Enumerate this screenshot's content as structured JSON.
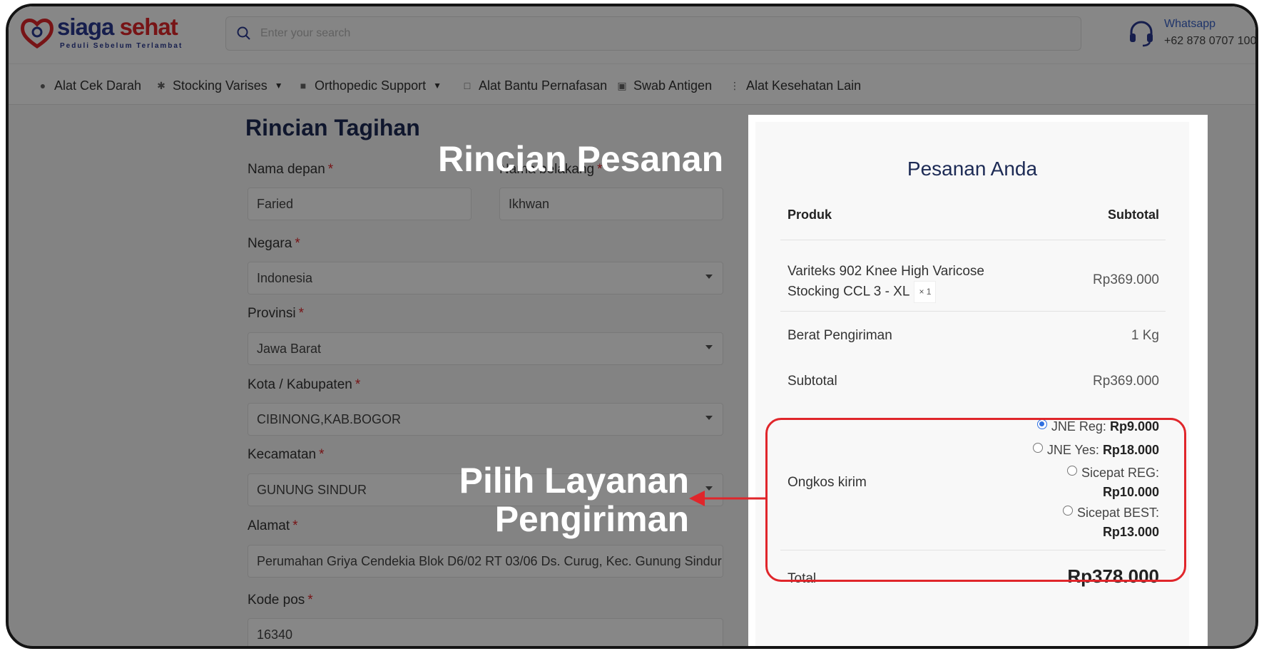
{
  "header": {
    "logo": {
      "brand_first": "siaga",
      "brand_second": "sehat",
      "tagline": "Peduli Sebelum Terlambat"
    },
    "search": {
      "placeholder": "Enter your search",
      "value": ""
    },
    "whatsapp": {
      "label": "Whatsapp",
      "number": "+62 878 0707 1000"
    }
  },
  "nav": {
    "items": [
      {
        "label": "Alat Cek Darah",
        "icon": "blood-drop-icon",
        "has_dropdown": false
      },
      {
        "label": "Stocking Varises",
        "icon": "leg-icon",
        "has_dropdown": true
      },
      {
        "label": "Orthopedic Support",
        "icon": "knee-support-icon",
        "has_dropdown": true
      },
      {
        "label": "Alat Bantu Pernafasan",
        "icon": "lungs-icon",
        "has_dropdown": false
      },
      {
        "label": "Swab Antigen",
        "icon": "test-kit-icon",
        "has_dropdown": false
      },
      {
        "label": "Alat Kesehatan Lain",
        "icon": "more-icon",
        "has_dropdown": false
      }
    ]
  },
  "form": {
    "title": "Rincian Tagihan",
    "required_mark": "*",
    "first_name": {
      "label": "Nama depan",
      "value": "Faried"
    },
    "last_name": {
      "label": "Nama belakang",
      "value": "Ikhwan"
    },
    "country": {
      "label": "Negara",
      "value": "Indonesia"
    },
    "province": {
      "label": "Provinsi",
      "value": "Jawa Barat"
    },
    "city": {
      "label": "Kota / Kabupaten",
      "value": "CIBINONG,KAB.BOGOR"
    },
    "district": {
      "label": "Kecamatan",
      "value": "GUNUNG SINDUR"
    },
    "address": {
      "label": "Alamat",
      "value": "Perumahan Griya Cendekia Blok D6/02 RT 03/06 Ds. Curug, Kec. Gunung Sindur"
    },
    "postal_code": {
      "label": "Kode pos",
      "value": "16340"
    }
  },
  "order": {
    "title": "Pesanan Anda",
    "col_product": "Produk",
    "col_subtotal": "Subtotal",
    "product": {
      "name": "Variteks 902 Knee High Varicose Stocking CCL 3 - XL",
      "qty": "× 1",
      "price": "Rp369.000"
    },
    "weight": {
      "label": "Berat Pengiriman",
      "value": "1 Kg"
    },
    "subtotal": {
      "label": "Subtotal",
      "value": "Rp369.000"
    },
    "shipping": {
      "label": "Ongkos kirim",
      "options": [
        {
          "name": "JNE Reg:",
          "price": "Rp9.000",
          "selected": true
        },
        {
          "name": "JNE Yes:",
          "price": "Rp18.000",
          "selected": false
        },
        {
          "name": "Sicepat REG:",
          "price": "Rp10.000",
          "selected": false
        },
        {
          "name": "Sicepat BEST:",
          "price": "Rp13.000",
          "selected": false
        }
      ]
    },
    "total": {
      "label": "Total",
      "value": "Rp378.000"
    }
  },
  "annotations": {
    "order_details": "Rincian Pesanan",
    "shipping_line1": "Pilih Layanan",
    "shipping_line2": "Pengiriman",
    "highlight_color": "#e0262b"
  }
}
